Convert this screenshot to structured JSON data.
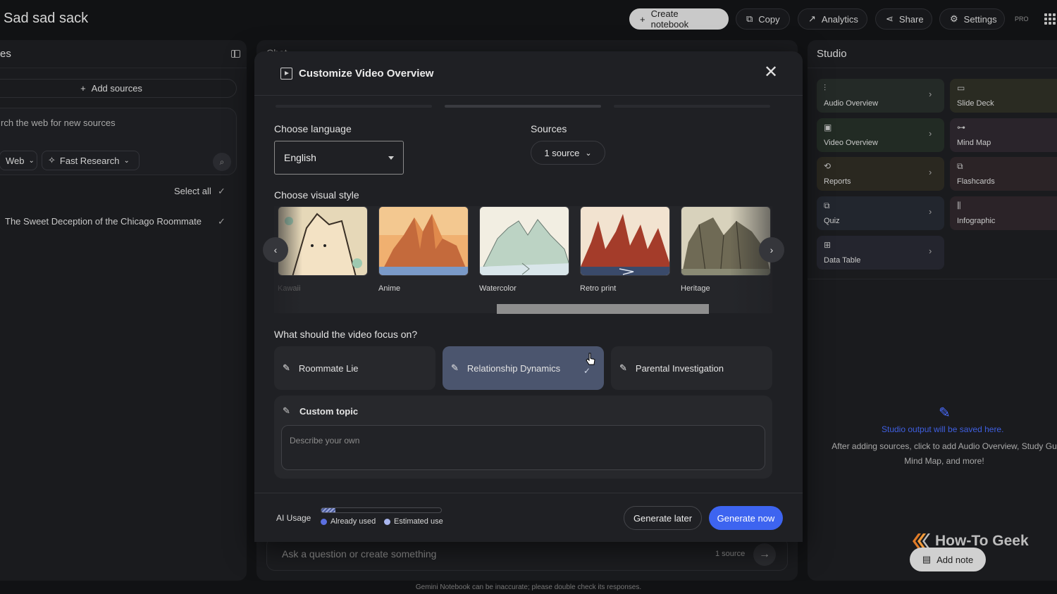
{
  "header": {
    "title": "Sad sad sack",
    "buttons": {
      "create_notebook": "Create notebook",
      "copy": "Copy",
      "analytics": "Analytics",
      "share": "Share",
      "settings": "Settings"
    },
    "pro_badge": "PRO"
  },
  "sources_panel": {
    "title": "es",
    "add_sources": "Add sources",
    "search_placeholder": "rch the web for new sources",
    "chip_web": "Web",
    "chip_research": "Fast Research",
    "select_all": "Select all",
    "items": [
      {
        "title": "The Sweet Deception of the Chicago Roommate",
        "checked": true
      }
    ]
  },
  "chat": {
    "title": "Chat",
    "input_placeholder": "Ask a question or create something",
    "source_count": "1 source",
    "disclaimer": "Gemini Notebook can be inaccurate; please double check its responses."
  },
  "modal": {
    "title": "Customize Video Overview",
    "language_label": "Choose language",
    "language_value": "English",
    "sources_label": "Sources",
    "sources_value": "1 source",
    "visual_style_label": "Choose visual style",
    "styles": [
      {
        "name": "Kawaii"
      },
      {
        "name": "Anime"
      },
      {
        "name": "Watercolor"
      },
      {
        "name": "Retro print"
      },
      {
        "name": "Heritage"
      }
    ],
    "focus_label": "What should the video focus on?",
    "focus_options": [
      {
        "label": "Roommate Lie",
        "selected": false
      },
      {
        "label": "Relationship Dynamics",
        "selected": true
      },
      {
        "label": "Parental Investigation",
        "selected": false
      }
    ],
    "custom_topic_label": "Custom topic",
    "custom_topic_placeholder": "Describe your own",
    "ai_usage_label": "AI Usage",
    "ai_usage_fraction": 0.12,
    "legend_used": "Already used",
    "legend_estimated": "Estimated use",
    "generate_later": "Generate later",
    "generate_now": "Generate now"
  },
  "studio": {
    "title": "Studio",
    "cards": [
      {
        "label": "Audio Overview",
        "icon": "audio-wave-icon",
        "color": "#242a27"
      },
      {
        "label": "Slide Deck",
        "icon": "slides-icon",
        "color": "#2a2b22"
      },
      {
        "label": "Video Overview",
        "icon": "video-icon",
        "color": "#222b24"
      },
      {
        "label": "Mind Map",
        "icon": "mind-map-icon",
        "color": "#2a242b"
      },
      {
        "label": "Reports",
        "icon": "reports-icon",
        "color": "#2a2820"
      },
      {
        "label": "Flashcards",
        "icon": "flashcards-icon",
        "color": "#2b2326"
      },
      {
        "label": "Quiz",
        "icon": "quiz-icon",
        "color": "#22262e"
      },
      {
        "label": "Infographic",
        "icon": "infographic-icon",
        "color": "#2b2328"
      },
      {
        "label": "Data Table",
        "icon": "table-icon",
        "color": "#24252e"
      }
    ],
    "empty_title": "Studio output will be saved here.",
    "empty_line1": "After adding sources, click to add Audio Overview, Study Gu",
    "empty_line2": "Mind Map, and more!",
    "add_note": "Add note"
  },
  "watermark": "How-To Geek",
  "colors": {
    "accent": "#3d64f0",
    "selected_focus": "#4b556e",
    "used_dot": "#5b6fe0",
    "estimated_dot": "#a9b6ee"
  }
}
